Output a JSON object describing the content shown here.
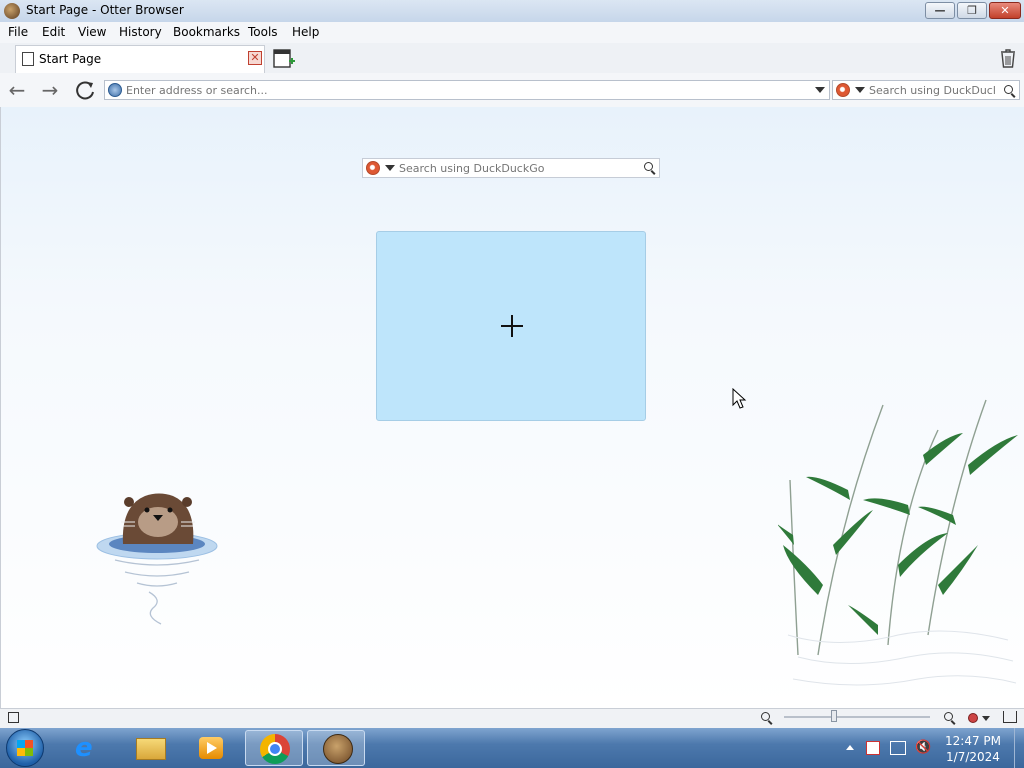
{
  "window": {
    "title": "Start Page - Otter Browser"
  },
  "menu": [
    "File",
    "Edit",
    "View",
    "History",
    "Bookmarks",
    "Tools",
    "Help"
  ],
  "tabs": [
    {
      "label": "Start Page"
    }
  ],
  "address": {
    "placeholder": "Enter address or search..."
  },
  "search": {
    "placeholder": "Search using DuckDuckGo"
  },
  "start_page": {
    "search_placeholder": "Search using DuckDuckGo"
  },
  "clock": {
    "time": "12:47 PM",
    "date": "1/7/2024"
  },
  "taskbar": {
    "items": [
      "start-orb",
      "internet-explorer",
      "file-explorer",
      "media-player",
      "chrome",
      "otter-browser"
    ]
  },
  "colors": {
    "tile": "#bee5fb",
    "taskbar": "#4d79ad",
    "close": "#c2412a"
  }
}
